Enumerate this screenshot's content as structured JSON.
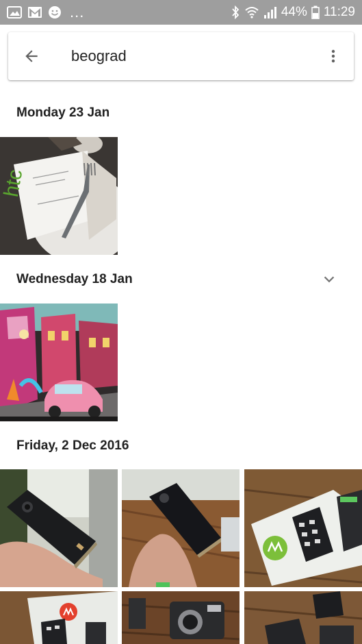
{
  "status_bar": {
    "battery": "44%",
    "time": "11:29",
    "overflow_dots": "...",
    "icons": [
      "gallery-notification-icon",
      "gmail-notification-icon",
      "smiley-notification-icon",
      "bluetooth-icon",
      "wifi-icon",
      "signal-icon",
      "battery-icon"
    ]
  },
  "search": {
    "query": "beograd",
    "back_icon": "arrow-back-icon",
    "menu_icon": "more-vert-icon"
  },
  "sections": [
    {
      "date": "Monday 23 Jan",
      "photo_count_visible": 1
    },
    {
      "date": "Wednesday 18 Jan",
      "photo_count_visible": 1,
      "expand_icon": "chevron-down-icon"
    },
    {
      "date": "Friday, 2 Dec 2016",
      "photo_count_visible": 6
    }
  ],
  "colors": {
    "status_bar": "#9e9e9e",
    "background": "#ffffff",
    "text_primary": "#212121",
    "icon_grey": "#757575"
  }
}
